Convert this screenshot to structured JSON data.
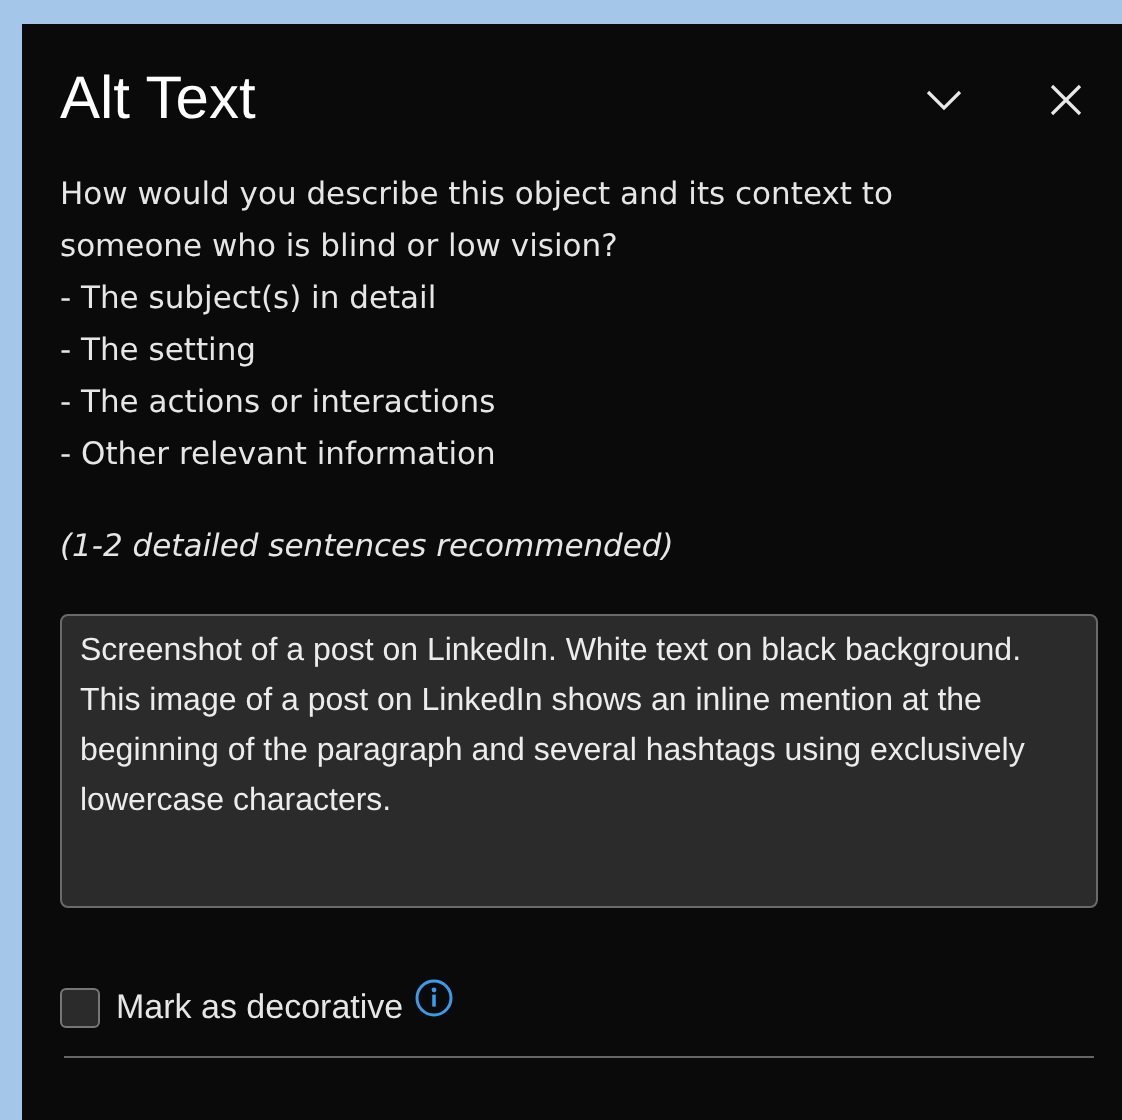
{
  "panel": {
    "title": "Alt Text"
  },
  "instructions": [
    "How would you describe this object and its context to someone who is blind or low vision?",
    "- The subject(s) in detail",
    "- The setting",
    "- The actions or interactions",
    "- Other relevant information"
  ],
  "hint": "(1-2 detailed sentences recommended)",
  "alt_text_field": {
    "value": "Screenshot of a post on LinkedIn. White text on black background. This image of a post on LinkedIn shows an inline mention at the beginning of the paragraph and several hashtags using exclusively lowercase characters."
  },
  "decorative": {
    "label": "Mark as decorative",
    "checked": false
  }
}
